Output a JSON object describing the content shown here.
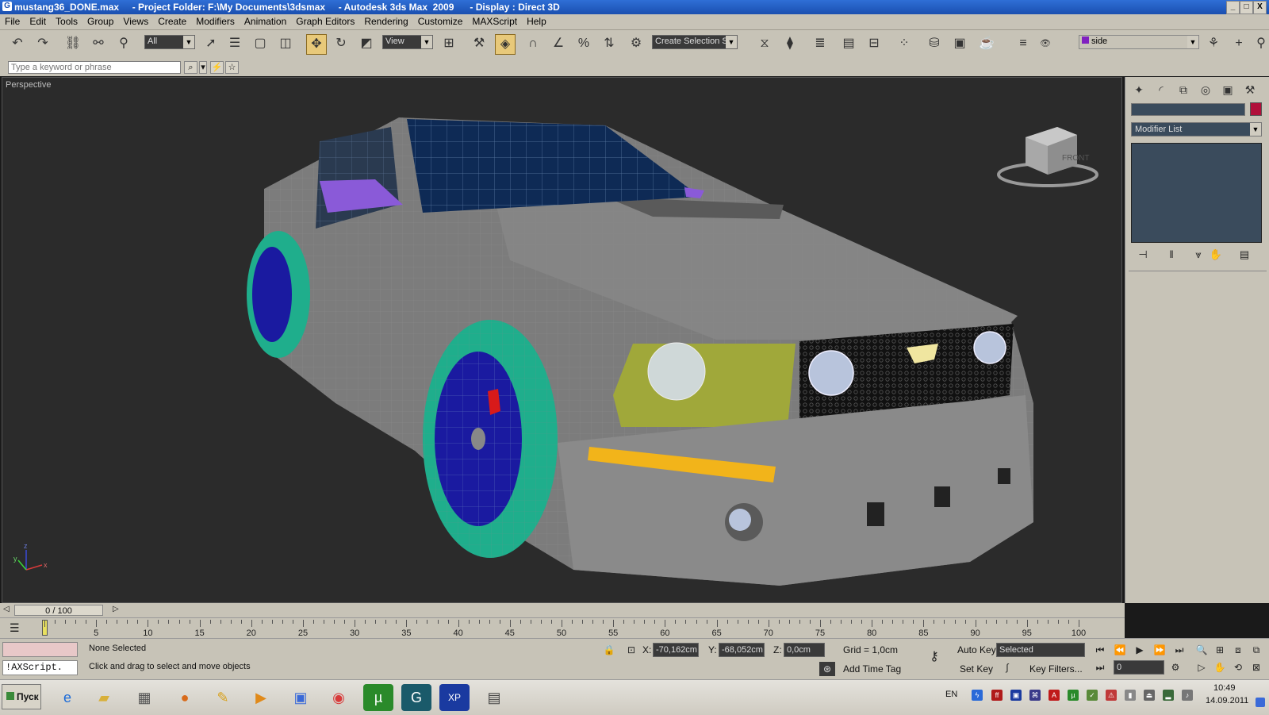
{
  "window": {
    "title": "mustang36_DONE.max     - Project Folder: F:\\My Documents\\3dsmax     - Autodesk 3ds Max  2009      - Display : Direct 3D",
    "controls": [
      "_",
      "□",
      "X"
    ]
  },
  "menu": {
    "items": [
      "File",
      "Edit",
      "Tools",
      "Group",
      "Views",
      "Create",
      "Modifiers",
      "Animation",
      "Graph Editors",
      "Rendering",
      "Customize",
      "MAXScript",
      "Help"
    ]
  },
  "toolbar": {
    "selection_filter": "All",
    "reference_coord": "View",
    "named_selection_placeholder": "Create Selection Se",
    "layer_name": "side"
  },
  "search": {
    "placeholder": "Type a keyword or phrase"
  },
  "viewport": {
    "label": "Perspective",
    "viewcube_label": "FRONT",
    "axis_labels": [
      "z",
      "y",
      "x"
    ]
  },
  "command_panel": {
    "modifier_list": "Modifier List",
    "object_color": "#b0103a"
  },
  "time_slider": {
    "label": "0 / 100"
  },
  "timeline": {
    "labels": [
      "5",
      "10",
      "15",
      "20",
      "25",
      "30",
      "35",
      "40",
      "45",
      "50",
      "55",
      "60",
      "65",
      "70",
      "75",
      "80",
      "85",
      "90",
      "95",
      "100"
    ]
  },
  "status": {
    "maxscript_text": "!AXScript.",
    "selection": "None Selected",
    "prompt": "Click and drag to select and move objects",
    "x_value": "-70,162cm",
    "y_value": "-68,052cm",
    "z_value": "0,0cm",
    "x_label": "X:",
    "y_label": "Y:",
    "z_label": "Z:",
    "grid": "Grid = 1,0cm",
    "add_time_tag": "Add Time Tag",
    "auto_key": "Auto Key",
    "set_key": "Set Key",
    "selected": "Selected",
    "key_filters": "Key Filters...",
    "frame": "0"
  },
  "taskbar": {
    "start": "Пуск",
    "lang": "EN",
    "time": "10:49",
    "date": "14.09.2011"
  }
}
